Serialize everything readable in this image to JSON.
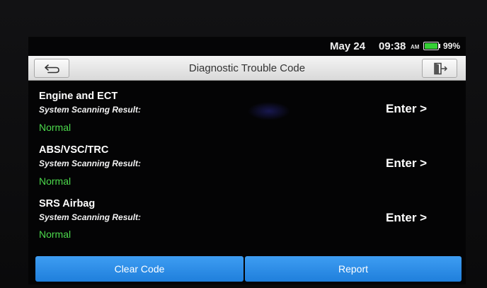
{
  "status": {
    "date": "May 24",
    "time": "09:38",
    "ampm": "AM",
    "battery_percent": "99%",
    "battery_level": 0.99,
    "battery_color": "#35d035"
  },
  "header": {
    "title": "Diagnostic Trouble Code",
    "back_icon": "back-arrow-icon",
    "exit_icon": "exit-door-icon"
  },
  "systems": [
    {
      "name": "Engine and ECT",
      "subtitle": "System Scanning Result:",
      "status": "Normal",
      "action": "Enter >"
    },
    {
      "name": "ABS/VSC/TRC",
      "subtitle": "System Scanning Result:",
      "status": "Normal",
      "action": "Enter >"
    },
    {
      "name": "SRS Airbag",
      "subtitle": "System Scanning Result:",
      "status": "Normal",
      "action": "Enter >"
    }
  ],
  "footer": {
    "clear_label": "Clear Code",
    "report_label": "Report"
  },
  "colors": {
    "normal_status": "#4cd94c",
    "button_blue": "#2a8de6"
  }
}
